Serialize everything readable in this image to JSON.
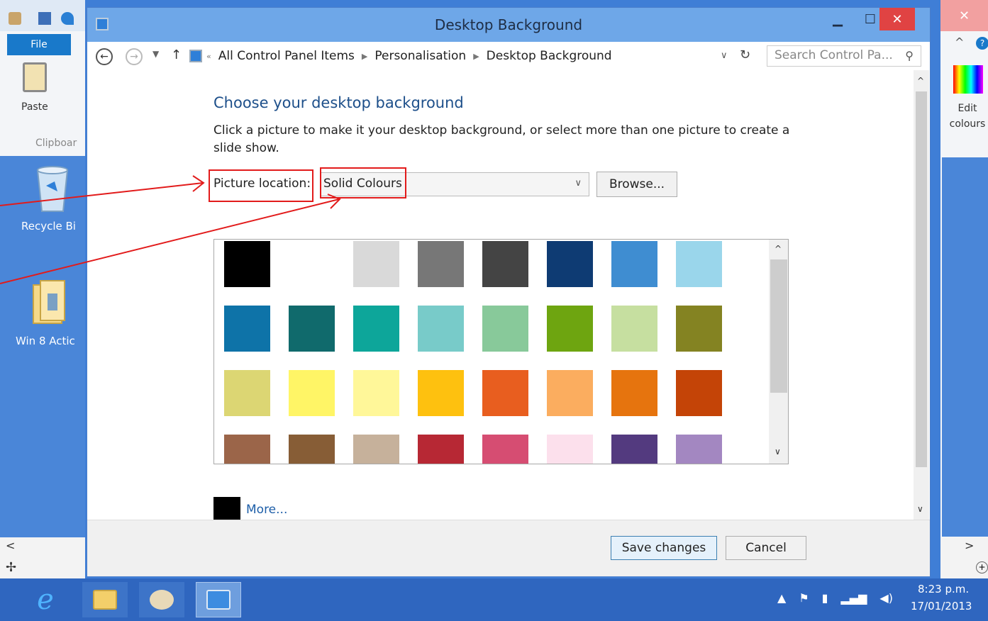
{
  "window": {
    "title": "Desktop Background"
  },
  "address": {
    "crumb_prefix": "«",
    "crumbs": [
      "All Control Panel Items",
      "Personalisation",
      "Desktop Background"
    ],
    "search_placeholder": "Search Control Pa..."
  },
  "content": {
    "heading": "Choose your desktop background",
    "description": "Click a picture to make it your desktop background, or select more than one picture to create a slide show.",
    "picture_location_label": "Picture location:",
    "picture_location_value": "Solid Colours",
    "browse_label": "Browse...",
    "more_label": "More...",
    "swatches": [
      "#000000",
      "#ffffff",
      "#d9d9d9",
      "#777777",
      "#444444",
      "#0e3b73",
      "#3f8dd1",
      "#9ad6eb",
      "#0e73a8",
      "#106a6c",
      "#0da69a",
      "#78cbc9",
      "#88c99a",
      "#6ea510",
      "#c6dfa0",
      "#848322",
      "#dcd673",
      "#fff566",
      "#fff799",
      "#fec10f",
      "#e85e1f",
      "#fbad5f",
      "#e6740e",
      "#c44407",
      "#9b6549",
      "#875d36",
      "#c6b19b",
      "#b72834",
      "#d64d72",
      "#fce0ec",
      "#533a7f",
      "#a387c1"
    ]
  },
  "footer": {
    "save_label": "Save changes",
    "cancel_label": "Cancel"
  },
  "paint": {
    "file_tab": "File",
    "paste_label": "Paste",
    "clipboard_label": "Clipboar",
    "edit_colours_label": "Edit colours"
  },
  "desktop": {
    "recycle_label": "Recycle Bi",
    "folder_label": "Win 8 Actic"
  },
  "taskbar": {
    "time": "8:23 p.m.",
    "date": "17/01/2013"
  },
  "colors": {
    "annotation_red": "#e21b1b",
    "close_red": "#e04343",
    "accent_blue": "#1d5ea8"
  }
}
